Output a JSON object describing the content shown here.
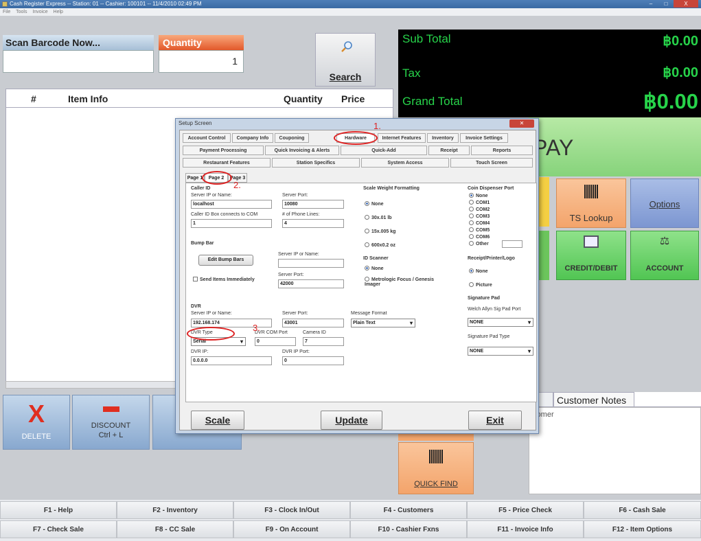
{
  "window": {
    "title": "Cash Register Express -- Station: 01 -- Cashier: 100101 -- 11/4/2010 02:49 PM",
    "min": "–",
    "max": "□",
    "close": "X"
  },
  "menu": [
    "File",
    "Tools",
    "Invoice",
    "Help"
  ],
  "scan": {
    "label": "Scan Barcode Now...",
    "value": ""
  },
  "quantity": {
    "label": "Quantity",
    "value": "1"
  },
  "search": {
    "label": "Search"
  },
  "table": {
    "col_num": "#",
    "col_item": "Item Info",
    "col_qty": "Quantity",
    "col_price": "Price"
  },
  "totals": {
    "sub_label": "Sub Total",
    "sub_value": "฿0.00",
    "tax_label": "Tax",
    "tax_value": "฿0.00",
    "grand_label": "Grand Total",
    "grand_value": "฿0.00"
  },
  "pay": {
    "label": "PAY"
  },
  "tiles": {
    "ts_lookup": "TS Lookup",
    "options": "Options",
    "credit": "CREDIT/DEBIT",
    "account": "ACCOUNT",
    "quick_find": "QUICK FIND"
  },
  "notes": {
    "tab1": "fo",
    "tab2": "Customer Notes",
    "body": "stomer"
  },
  "actions": {
    "delete": "DELETE",
    "discount": "DISCOUNT",
    "discount_sub": "Ctrl + L"
  },
  "fkeys": [
    "F1 - Help",
    "F2 - Inventory",
    "F3 - Clock In/Out",
    "F4 - Customers",
    "F5 - Price Check",
    "F6 - Cash Sale",
    "F7 - Check Sale",
    "F8 - CC Sale",
    "F9 - On Account",
    "F10 - Cashier Fxns",
    "F11 - Invoice Info",
    "F12 - Item Options"
  ],
  "dialog": {
    "title": "Setup Screen",
    "tabs_row1": [
      "Account Control",
      "Company Info",
      "Couponing",
      "Hardware",
      "Internet Features",
      "Inventory",
      "Invoice Settings"
    ],
    "tabs_row2": [
      "Payment Processing",
      "Quick Invoicing & Alerts",
      "Quick-Add",
      "Receipt",
      "Reports"
    ],
    "tabs_row3": [
      "Restaurant Features",
      "Station Specifics",
      "System Access",
      "Touch Screen"
    ],
    "subtabs": [
      "Page 1",
      "Page 2",
      "Page 3"
    ],
    "annotations": {
      "n1": "1.",
      "n2": "2.",
      "n3": "3."
    },
    "caller_id": {
      "heading": "Caller ID",
      "server_label": "Server IP or Name:",
      "server_value": "localhost",
      "port_label": "Server Port:",
      "port_value": "10080",
      "com_label": "Caller ID Box connects to COM",
      "com_value": "1",
      "lines_label": "# of Phone Lines:",
      "lines_value": "4"
    },
    "bump_bar": {
      "heading": "Bump Bar",
      "edit_btn": "Edit Bump Bars",
      "server_label": "Server IP or Name:",
      "server_value": "",
      "port_label": "Server Port:",
      "port_value": "42000",
      "send_label": "Send Items Immediately"
    },
    "dvr": {
      "heading": "DVR",
      "server_label": "Server IP or Name:",
      "server_value": "192.168.174",
      "port_label": "Server Port:",
      "port_value": "43001",
      "msg_label": "Message Format",
      "msg_value": "Plain Text",
      "type_label": "DVR Type",
      "type_value": "Serial",
      "com_label": "DVR COM Port",
      "com_value": "0",
      "cam_label": "Camera ID",
      "cam_value": "7",
      "ip_label": "DVR IP:",
      "ip_value": "0.0.0.0",
      "ipport_label": "DVR IP Port:",
      "ipport_value": "0"
    },
    "scale": {
      "heading": "Scale Weight Formatting",
      "options": [
        "None",
        "30x.01 lb",
        "15x.005 kg",
        "600x0.2 oz"
      ]
    },
    "id_scanner": {
      "heading": "ID Scanner",
      "options": [
        "None",
        "Metrologic Focus / Genesis Imager"
      ]
    },
    "coin": {
      "heading": "Coin Dispenser Port",
      "options": [
        "None",
        "COM1",
        "COM2",
        "COM3",
        "COM4",
        "COM5",
        "COM6",
        "Other"
      ]
    },
    "receipt_logo": {
      "heading": "Receipt/Printer/Logo",
      "options": [
        "None",
        "Picture"
      ]
    },
    "sig_pad": {
      "heading": "Signature Pad",
      "welch_label": "Welch Allyn Sig Pad Port",
      "welch_value": "NONE",
      "type_label": "Signature Pad Type",
      "type_value": "NONE"
    },
    "buttons": {
      "scale": "Scale",
      "update": "Update",
      "exit": "Exit"
    }
  }
}
